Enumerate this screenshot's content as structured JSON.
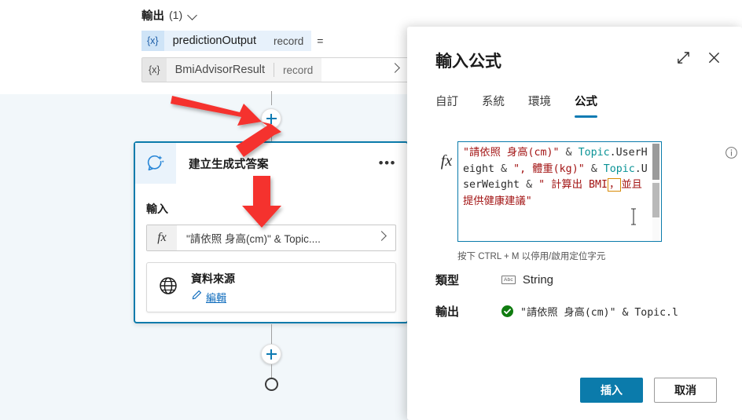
{
  "canvas": {
    "output_section": {
      "label": "輸出",
      "count": "(1)",
      "chevron_icon": "chevron-down-icon",
      "chip": {
        "var_icon": "{x}",
        "name": "predictionOutput",
        "type": "record",
        "equals": "="
      },
      "value_chip": {
        "var_icon": "{x}",
        "name": "BmiAdvisorResult",
        "type": "record",
        "chevron_icon": "chevron-right-icon"
      }
    },
    "add_button_top": {
      "icon": "plus-icon"
    },
    "add_button_bottom": {
      "icon": "plus-icon"
    },
    "node": {
      "icon": "generative-answers-icon",
      "title": "建立生成式答案",
      "more_icon": "ellipsis-icon",
      "input_label": "輸入",
      "formula_field": {
        "fx_icon": "fx-icon",
        "value": "\"請依照 身高(cm)\" & Topic....",
        "chevron_icon": "chevron-right-icon"
      },
      "data_source": {
        "globe_icon": "globe-icon",
        "title": "資料來源",
        "edit_icon": "pencil-icon",
        "edit_label": "編輯"
      }
    },
    "annotations": {
      "arrow1": "red-arrow-pointing-to-add-button",
      "arrow2": "red-arrow-pointing-to-node-header",
      "arrow3": "red-arrow-pointing-to-formula-field"
    },
    "end_node": {
      "icon": "end-circle-icon"
    }
  },
  "panel": {
    "title": "輸入公式",
    "expand_icon": "expand-diagonal-icon",
    "close_icon": "close-icon",
    "tabs": [
      {
        "label": "自訂",
        "active": false
      },
      {
        "label": "系統",
        "active": false
      },
      {
        "label": "環境",
        "active": false
      },
      {
        "label": "公式",
        "active": true
      }
    ],
    "editor": {
      "fx_icon": "fx-icon",
      "info_icon": "info-icon",
      "tokens": [
        {
          "t": "\"請依照 身高(cm)\"",
          "k": "str"
        },
        {
          "t": " & ",
          "k": "op"
        },
        {
          "t": "Topic",
          "k": "id"
        },
        {
          "t": ".",
          "k": "dot"
        },
        {
          "t": "UserHeight",
          "k": "mem"
        },
        {
          "t": " & ",
          "k": "op"
        },
        {
          "t": "\", 體重(kg)\"",
          "k": "str"
        },
        {
          "t": " & ",
          "k": "op"
        },
        {
          "t": "Topic",
          "k": "id"
        },
        {
          "t": ".",
          "k": "dot"
        },
        {
          "t": "UserWeight",
          "k": "mem"
        },
        {
          "t": " & ",
          "k": "op"
        },
        {
          "t": "\" 計算出 BMI",
          "k": "str"
        },
        {
          "t": "，",
          "k": "err"
        },
        {
          "t": "並且提供健康建議\"",
          "k": "str"
        }
      ],
      "plain_text": "\"請依照 身高(cm)\" & Topic.UserHeight & \", 體重(kg)\" & Topic.UserWeight & \" 計算出 BMI，並且提供健康建議\"",
      "scrollbar": "vertical-scrollbar"
    },
    "hint": "按下 CTRL + M 以停用/啟用定位字元",
    "type_row": {
      "label": "類型",
      "type_icon": "abc-string-icon",
      "value": "String"
    },
    "output_row": {
      "label": "輸出",
      "status_icon": "check-circle-icon",
      "value": "\"請依照 身高(cm)\" & Topic.l"
    },
    "buttons": {
      "primary": "插入",
      "secondary": "取消"
    }
  },
  "colors": {
    "accent": "#0b7bab",
    "canvas_bg": "#f2f7fa",
    "string": "#a31515",
    "identifier": "#0a9396",
    "error_box": "#d88a04",
    "success": "#107c10",
    "annotation_red": "#f5322e",
    "link": "#0f6cbd"
  }
}
